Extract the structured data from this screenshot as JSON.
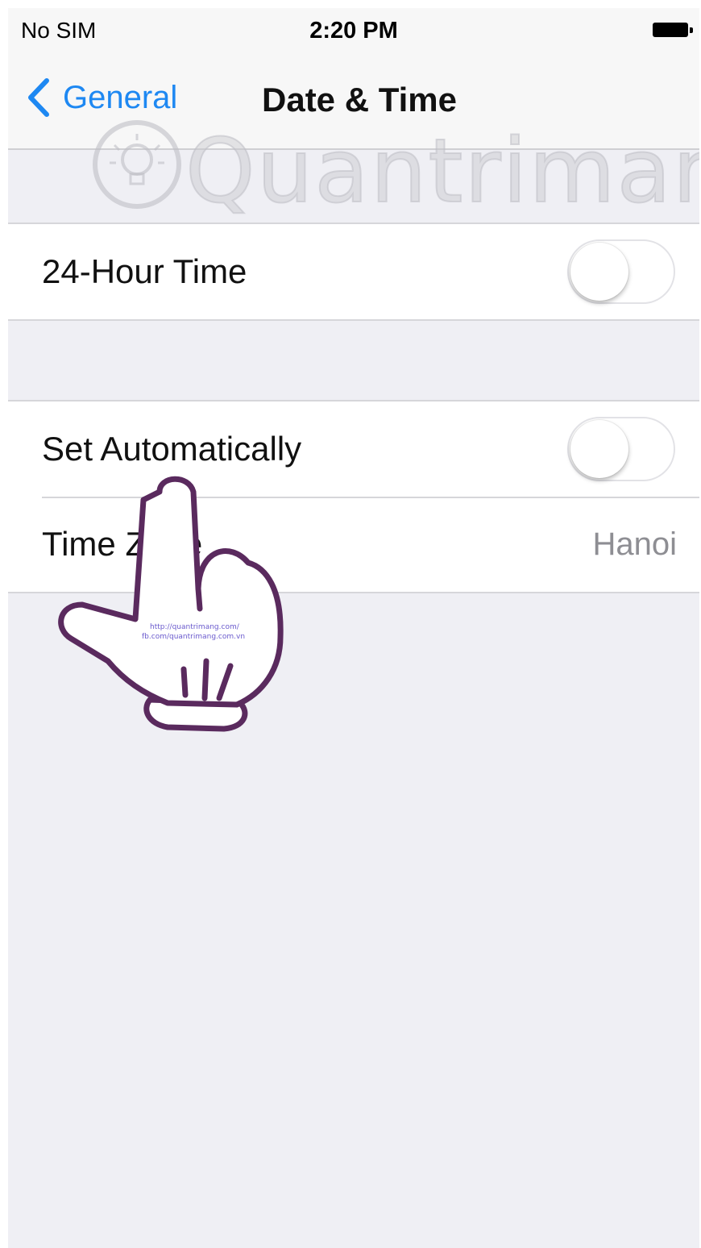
{
  "status_bar": {
    "carrier": "No SIM",
    "time": "2:20 PM"
  },
  "nav": {
    "back_label": "General",
    "title": "Date & Time"
  },
  "settings": {
    "hour24": {
      "label": "24-Hour Time",
      "on": false
    },
    "set_automatically": {
      "label": "Set Automatically",
      "on": false
    },
    "time_zone": {
      "label": "Time Zone",
      "value": "Hanoi"
    }
  },
  "watermark": {
    "text": "Quantrimang",
    "hand_url_lines": [
      "http://quantrimang.com/",
      "fb.com/quantrimang.com.vn"
    ]
  },
  "colors": {
    "accent": "#1e88f2",
    "background": "#efeff4",
    "hand_outline": "#5a2a5e"
  }
}
